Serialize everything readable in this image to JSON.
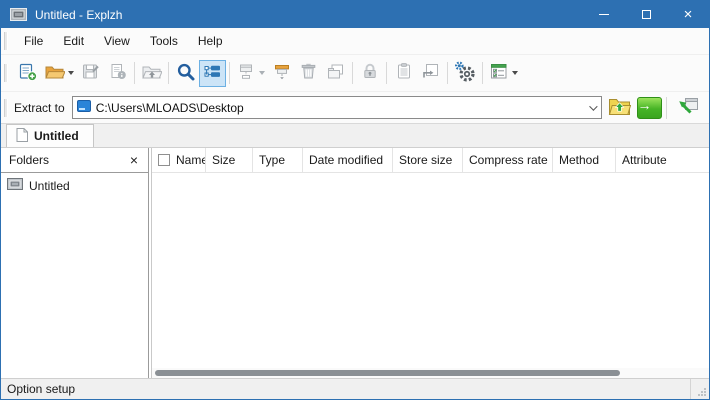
{
  "window": {
    "title": "Untitled - Explzh"
  },
  "titlebar": {
    "close_glyph": "×"
  },
  "menu": {
    "items": [
      "File",
      "Edit",
      "View",
      "Tools",
      "Help"
    ]
  },
  "toolbar": {
    "buttons": [
      {
        "name": "new-archive",
        "enabled": true
      },
      {
        "name": "open-archive",
        "enabled": true,
        "dropdown": true
      },
      {
        "name": "save-as",
        "enabled": false
      },
      {
        "name": "archive-info",
        "enabled": false
      },
      {
        "name": "extract-to-folder",
        "enabled": false
      },
      {
        "name": "search",
        "enabled": true
      },
      {
        "name": "toggle-tree-view",
        "enabled": true,
        "pressed": true
      },
      {
        "name": "add-files",
        "enabled": false,
        "dropdown": true
      },
      {
        "name": "extract-files",
        "enabled": true
      },
      {
        "name": "delete",
        "enabled": false
      },
      {
        "name": "view-in-explorer",
        "enabled": false
      },
      {
        "name": "lock",
        "enabled": false
      },
      {
        "name": "clipboard",
        "enabled": false
      },
      {
        "name": "open-with",
        "enabled": false
      },
      {
        "name": "settings",
        "enabled": true
      },
      {
        "name": "view-options",
        "enabled": true,
        "dropdown": true
      }
    ]
  },
  "extract_bar": {
    "label": "Extract to",
    "path": "C:\\Users\\MLOADS\\Desktop"
  },
  "tabs": [
    {
      "label": "Untitled",
      "active": true
    }
  ],
  "folders_panel": {
    "title": "Folders",
    "close_glyph": "×",
    "items": [
      {
        "label": "Untitled"
      }
    ]
  },
  "file_list": {
    "columns": [
      "Name",
      "Size",
      "Type",
      "Date modified",
      "Store size",
      "Compress rate",
      "Method",
      "Attribute"
    ],
    "rows": []
  },
  "status_bar": {
    "text": "Option setup"
  },
  "colors": {
    "titlebar": "#2d70b2",
    "pressed_bg": "#cce4f7",
    "pressed_border": "#6cb0e3",
    "accent_blue": "#2e77b5",
    "accent_green": "#3fae2a",
    "folder_orange": "#e8a33d"
  }
}
